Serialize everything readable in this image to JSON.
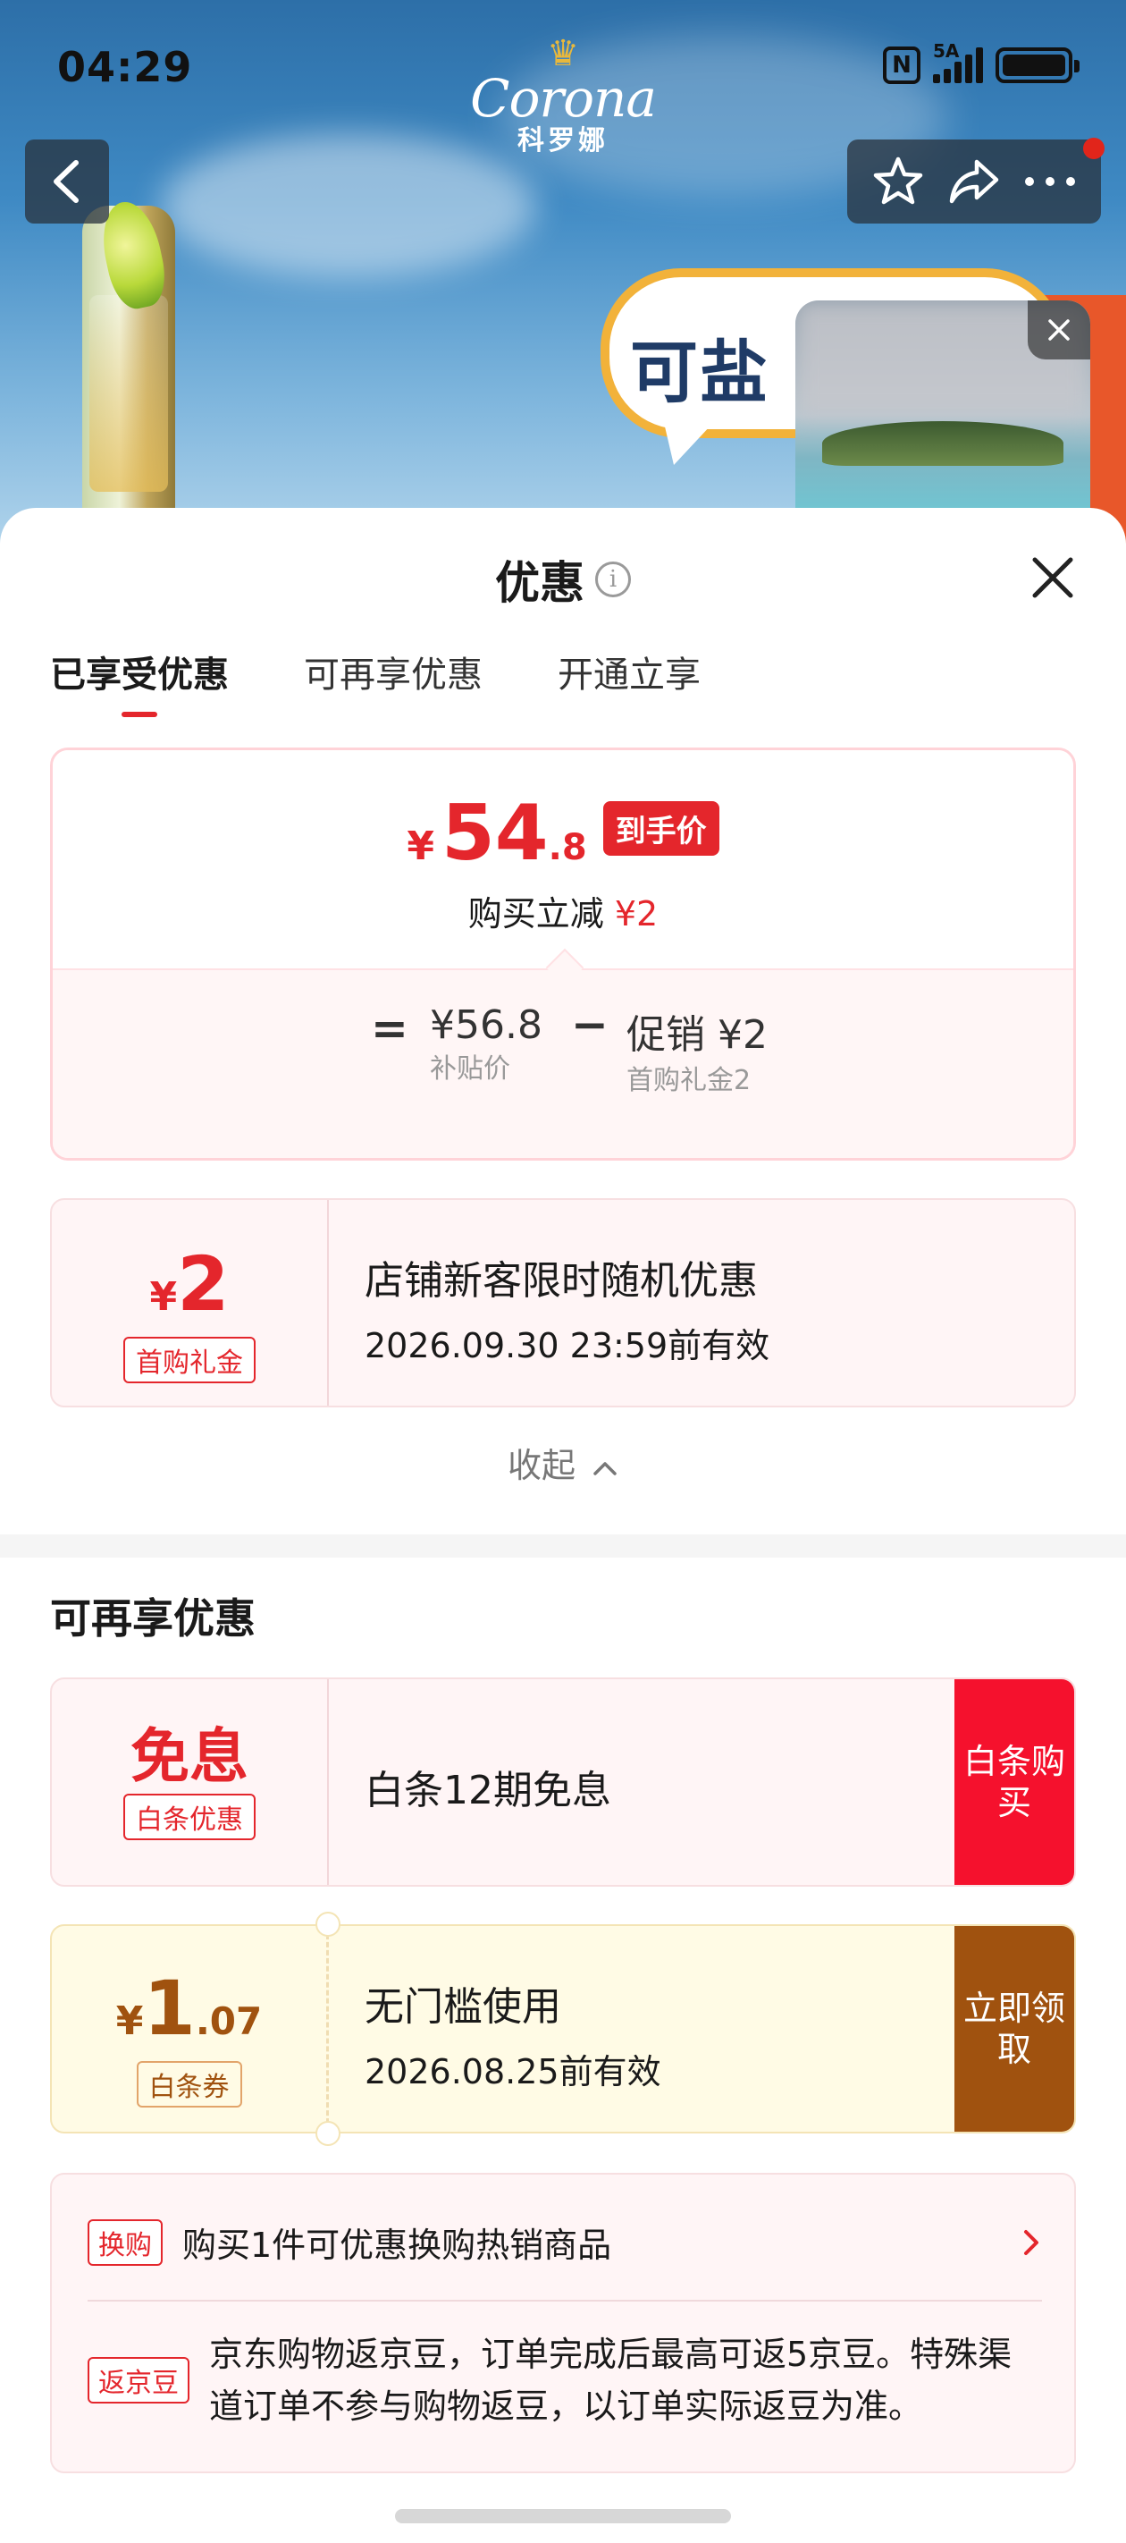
{
  "status_bar": {
    "time": "04:29",
    "network": "5A",
    "nfc": "N"
  },
  "brand": {
    "logo_text": "Corona",
    "logo_cn": "科罗娜",
    "crown": "♛"
  },
  "banner": {
    "headline": "可盐"
  },
  "sheet": {
    "title": "优惠",
    "info_glyph": "i",
    "tabs": [
      {
        "label": "已享受优惠",
        "active": true
      },
      {
        "label": "可再享优惠",
        "active": false
      },
      {
        "label": "开通立享",
        "active": false
      }
    ]
  },
  "price_card": {
    "currency": "¥",
    "price_int": "54",
    "price_dec": ".8",
    "badge": "到手价",
    "reduce_label": "购买立减",
    "reduce_amount": "¥2",
    "eq": "=",
    "minus": "−",
    "subsidy_value": "¥56.8",
    "subsidy_label": "补贴价",
    "promo_value": "促销 ¥2",
    "promo_label": "首购礼金2"
  },
  "enjoyed_coupon": {
    "currency": "¥",
    "amount": "2",
    "tag": "首购礼金",
    "title": "店铺新客限时随机优惠",
    "expiry": "2026.09.30 23:59前有效"
  },
  "collapse_label": "收起",
  "more_section": {
    "title": "可再享优惠",
    "baitiao": {
      "big": "免息",
      "tag": "白条优惠",
      "title": "白条12期免息",
      "button": "白条购买"
    },
    "voucher": {
      "currency": "¥",
      "amount_int": "1",
      "amount_dec": ".07",
      "tag": "白条券",
      "title": "无门槛使用",
      "expiry": "2026.08.25前有效",
      "button": "立即领取"
    },
    "extras": [
      {
        "tag": "换购",
        "text": "购买1件可优惠换购热销商品"
      },
      {
        "tag": "返京豆",
        "text": "京东购物返京豆，订单完成后最高可返5京豆。特殊渠道订单不参与购物返豆，以订单实际返豆为准。"
      }
    ]
  },
  "colors": {
    "accent_red": "#e4262c",
    "voucher_brown": "#a0520f",
    "card_pink": "#fff5f6",
    "voucher_yellow": "#fffbe5"
  },
  "icons": [
    "back-arrow-icon",
    "star-icon",
    "share-icon",
    "more-icon",
    "close-icon",
    "info-icon",
    "chevron-up-icon",
    "chevron-right-icon"
  ]
}
